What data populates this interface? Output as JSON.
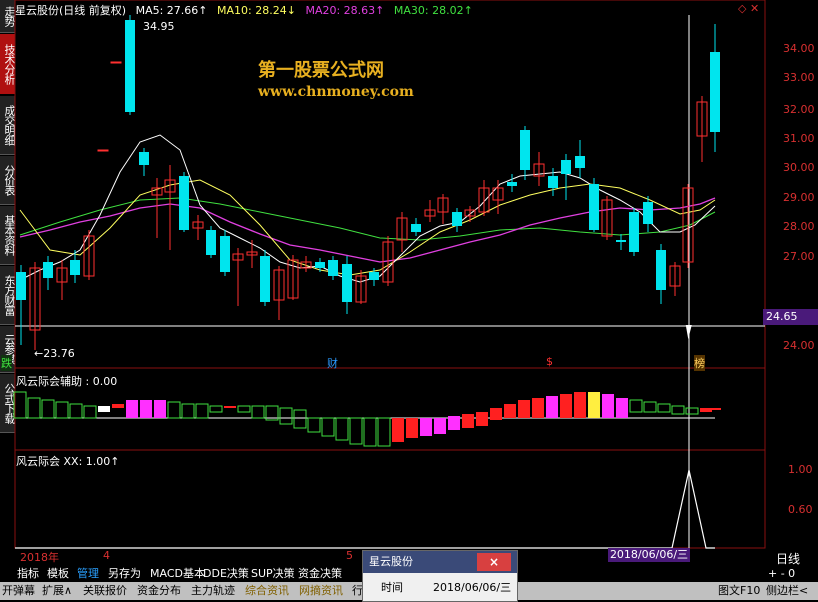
{
  "sidebar": {
    "tabs": [
      {
        "label": "走势",
        "active": false
      },
      {
        "label": "技术分析",
        "active": true
      },
      {
        "label": "成交明细",
        "active": false
      },
      {
        "label": "分价表",
        "active": false
      },
      {
        "label": "基本资料",
        "active": false
      },
      {
        "label": "东方财富",
        "active": false
      },
      {
        "label": "云参谋",
        "active": false
      },
      {
        "label": "公式下载",
        "active": false
      }
    ]
  },
  "header": {
    "stock": "星云股份(日线 前复权)",
    "ma5": "MA5: 27.66↑",
    "ma10": "MA10: 28.24↓",
    "ma20": "MA20: 28.63↑",
    "ma30": "MA30: 28.02↑"
  },
  "watermark": {
    "title": "第一股票公式网",
    "url": "www.chnmoney.com"
  },
  "price_axis": [
    "34.00",
    "33.00",
    "32.00",
    "31.00",
    "30.00",
    "29.00",
    "28.00",
    "27.00",
    "24.00"
  ],
  "price_tag": "24.65",
  "annotations": {
    "high": "34.95",
    "low": "←23.76",
    "marker_left": "跌",
    "marker_cai": "财",
    "marker_s": "$",
    "marker_bang": "榜"
  },
  "indicator1": {
    "title": "风云际会辅助 : 0.00"
  },
  "indicator2": {
    "title": "风云际会 XX: 1.00↑",
    "axis": [
      "1.00",
      "0.60"
    ]
  },
  "time_axis": {
    "year": "2018年",
    "m4": "4",
    "m5": "5",
    "date": "2018/06/06/三"
  },
  "right_bottom": {
    "label": "日线",
    "zoom": "+ -  0"
  },
  "toolbar": {
    "items": [
      "指标",
      "模板",
      "管理",
      "另存为",
      "MACD基本",
      "DDE决策",
      "SUP决策",
      "资金决策"
    ]
  },
  "bottombar": {
    "items": [
      "开弹幕",
      "扩展∧",
      "关联报价",
      "资金分布",
      "主力轨迹",
      "综合资讯",
      "网摘资讯",
      "行"
    ],
    "right1": "图文F10",
    "right2": "侧边栏<"
  },
  "popup": {
    "title": "星云股份",
    "close": "×",
    "row_label": "时间",
    "row_value": "2018/06/06/三"
  },
  "colors": {
    "up": "#ff3030",
    "down": "#00e5ee",
    "ma5": "#ffffff",
    "ma10": "#ffff60",
    "ma20": "#e040e0",
    "ma30": "#40e040"
  }
}
